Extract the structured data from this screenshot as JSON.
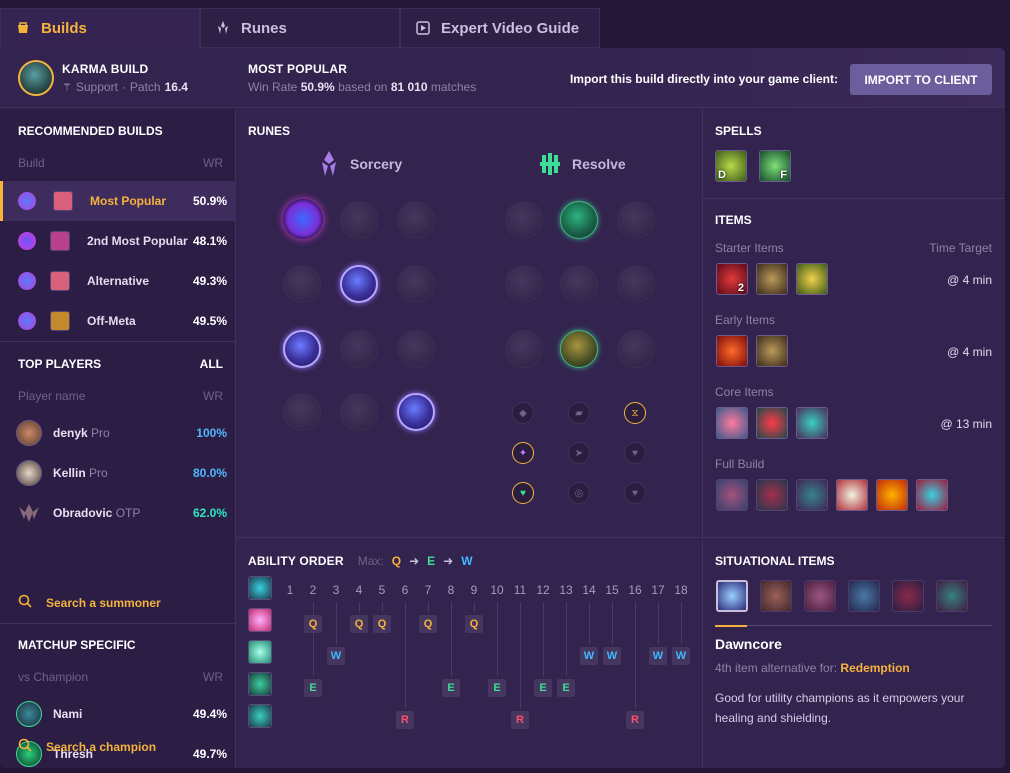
{
  "tabs": [
    {
      "label": "Builds",
      "icon": "builds-icon",
      "active": true
    },
    {
      "label": "Runes",
      "icon": "runes-icon",
      "active": false
    },
    {
      "label": "Expert Video Guide",
      "icon": "video-icon",
      "active": false
    }
  ],
  "header": {
    "champion_title": "KARMA BUILD",
    "role": "Support",
    "patch_label": "Patch",
    "patch": "16.4",
    "most_popular_title": "MOST POPULAR",
    "winrate_label": "Win Rate",
    "winrate": "50.9%",
    "based_on": "based on",
    "matches": "81 010",
    "matches_label": "matches",
    "import_text": "Import this build directly into your game client:",
    "import_button": "IMPORT TO CLIENT"
  },
  "recommended": {
    "title": "RECOMMENDED BUILDS",
    "col_build": "Build",
    "col_wr": "WR",
    "builds": [
      {
        "name": "Most Popular",
        "wr": "50.9%",
        "active": true
      },
      {
        "name": "2nd Most Popular",
        "wr": "48.1%",
        "active": false
      },
      {
        "name": "Alternative",
        "wr": "49.3%",
        "active": false
      },
      {
        "name": "Off-Meta",
        "wr": "49.5%",
        "active": false
      }
    ]
  },
  "top_players": {
    "title": "TOP PLAYERS",
    "all_label": "ALL",
    "col_player": "Player name",
    "col_wr": "WR",
    "players": [
      {
        "name": "denyk",
        "tag": "Pro",
        "wr": "100%",
        "color": "#4fb6ff"
      },
      {
        "name": "Kellin",
        "tag": "Pro",
        "wr": "80.0%",
        "color": "#4fb6ff"
      },
      {
        "name": "Obradovic",
        "tag": "OTP",
        "wr": "62.0%",
        "color": "#2ee6c8"
      }
    ],
    "search": "Search a summoner"
  },
  "matchup": {
    "title": "MATCHUP SPECIFIC",
    "col_vs": "vs Champion",
    "col_wr": "WR",
    "rows": [
      {
        "name": "Nami",
        "wr": "49.4%"
      },
      {
        "name": "Thresh",
        "wr": "49.7%"
      }
    ],
    "search": "Search a champion"
  },
  "runes": {
    "title": "RUNES",
    "primary": "Sorcery",
    "secondary": "Resolve"
  },
  "spells": {
    "title": "SPELLS",
    "items": [
      {
        "key": "D",
        "icon": "ignite-icon"
      },
      {
        "key": "F",
        "icon": "flash-icon"
      }
    ]
  },
  "items": {
    "title": "ITEMS",
    "starter_label": "Starter Items",
    "time_target_label": "Time Target",
    "starter_time": "@ 4 min",
    "starter_count": "2",
    "early_label": "Early Items",
    "early_time": "@ 4 min",
    "core_label": "Core Items",
    "core_time": "@ 13 min",
    "full_label": "Full Build"
  },
  "ability_order": {
    "title": "ABILITY ORDER",
    "max_label": "Max:",
    "max_order": [
      "Q",
      "E",
      "W"
    ],
    "levels": [
      "1",
      "2",
      "3",
      "4",
      "5",
      "6",
      "7",
      "8",
      "9",
      "10",
      "11",
      "12",
      "13",
      "14",
      "15",
      "16",
      "17",
      "18"
    ],
    "skills": [
      {
        "key": "Q",
        "levels": [
          2,
          4,
          5,
          7,
          9
        ]
      },
      {
        "key": "W",
        "levels": [
          3,
          14,
          15,
          17,
          18
        ]
      },
      {
        "key": "E",
        "levels": [
          2,
          8,
          10,
          12,
          13
        ]
      },
      {
        "key": "R",
        "levels": [
          6,
          11,
          16
        ]
      }
    ]
  },
  "situational": {
    "title": "SITUATIONAL ITEMS",
    "selected_name": "Dawncore",
    "alt_text": "4th item alternative for:",
    "alt_item": "Redemption",
    "description": "Good for utility champions as it empowers your healing and shielding."
  },
  "colors": {
    "accent": "#f5b33d",
    "q": "#f5b33d",
    "w": "#3eb9ff",
    "e": "#3ddc97",
    "r": "#ff4e6a"
  }
}
